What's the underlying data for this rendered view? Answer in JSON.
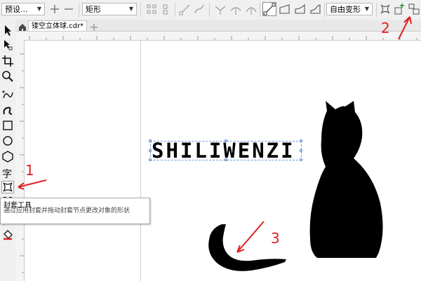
{
  "property_bar": {
    "preset_value": "预设...",
    "shape_value": "矩形",
    "mode_value": "自由变形"
  },
  "document_tab": {
    "name": "镂空立体球.cdr*"
  },
  "canvas": {
    "text_object": "SHILIWENZI"
  },
  "tooltip": {
    "title": "封套工具",
    "description": "通过应用封套并拖动封套节点更改对象的形状"
  },
  "annotations": {
    "one": "1",
    "two": "2",
    "three": "3",
    "color": "#e02020"
  },
  "icons": [
    "plus-icon",
    "minus-icon",
    "pick-tool-icon",
    "shape-tool-icon",
    "crop-tool-icon",
    "zoom-tool-icon",
    "freehand-tool-icon",
    "artistic-media-icon",
    "rectangle-tool-icon",
    "ellipse-tool-icon",
    "polygon-tool-icon",
    "text-tool-icon",
    "envelope-tool-icon",
    "transparency-tool-icon",
    "eyedropper-tool-icon",
    "fill-tool-icon",
    "home-icon",
    "add-tab-icon"
  ]
}
